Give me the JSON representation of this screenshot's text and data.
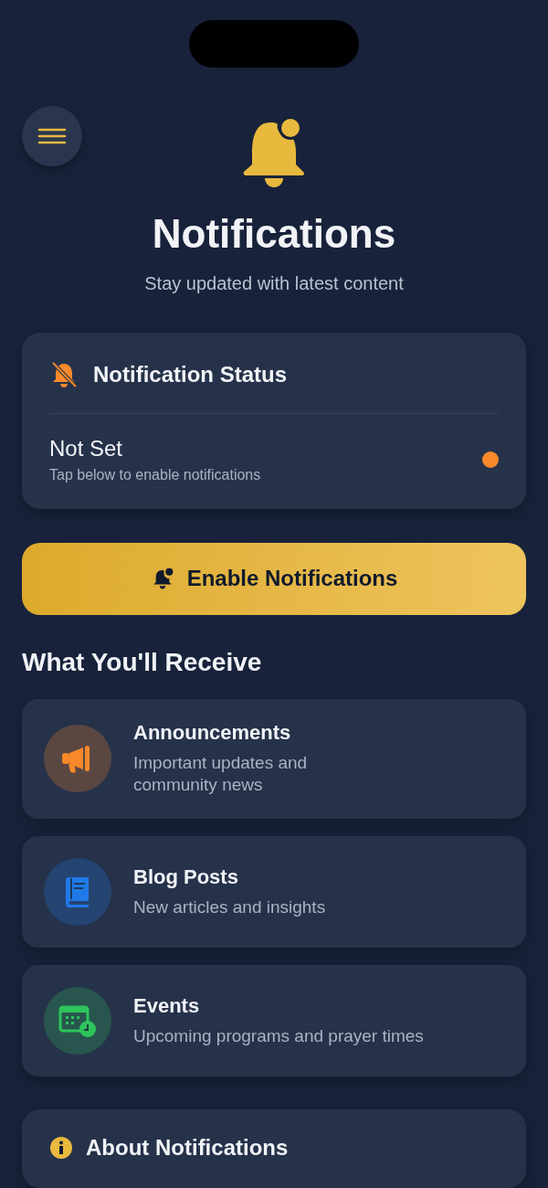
{
  "header": {
    "title": "Notifications",
    "subtitle": "Stay updated with latest content"
  },
  "status_card": {
    "title": "Notification Status",
    "enabled": false,
    "status": "Not Set",
    "hint": "Tap below to enable notifications"
  },
  "enable_button": {
    "label": "Enable Notifications"
  },
  "section_title": "What You'll Receive",
  "items": [
    {
      "kind": "announcements",
      "color": "#f7892b",
      "title": "Announcements",
      "description": "Important updates and community news"
    },
    {
      "kind": "blog",
      "color": "#1f7ae8",
      "title": "Blog Posts",
      "description": "New articles and insights"
    },
    {
      "kind": "events",
      "color": "#2ec45c",
      "title": "Events",
      "description": "Upcoming programs and prayer times"
    }
  ],
  "about_card": {
    "title": "About Notifications"
  }
}
